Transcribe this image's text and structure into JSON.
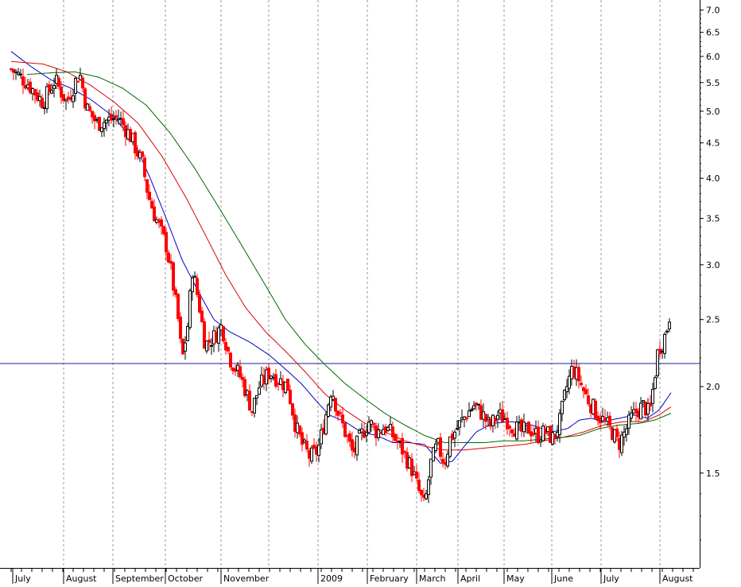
{
  "chart_data": {
    "type": "line",
    "title": "",
    "xlabel": "",
    "ylabel": "",
    "y_scale": "log",
    "ylim": [
      1.1,
      7.2
    ],
    "grid": "vertical dotted",
    "legend": "none",
    "y_ticks": [
      {
        "value": 7.0,
        "label": "7.0"
      },
      {
        "value": 6.5,
        "label": "6.5"
      },
      {
        "value": 6.0,
        "label": "6.0"
      },
      {
        "value": 5.5,
        "label": "5.5"
      },
      {
        "value": 5.0,
        "label": "5.0"
      },
      {
        "value": 4.5,
        "label": "4.5"
      },
      {
        "value": 4.0,
        "label": "4.0"
      },
      {
        "value": 3.5,
        "label": "3.5"
      },
      {
        "value": 3.0,
        "label": "3.0"
      },
      {
        "value": 2.5,
        "label": "2.5"
      },
      {
        "value": 2.0,
        "label": "2.0"
      },
      {
        "value": 1.5,
        "label": "1.5"
      }
    ],
    "x_labels": [
      {
        "label": "July",
        "t": 2
      },
      {
        "label": "August",
        "t": 66
      },
      {
        "label": "September",
        "t": 128
      },
      {
        "label": "October",
        "t": 194
      },
      {
        "label": "November",
        "t": 264
      },
      {
        "label": "2009",
        "t": 386
      },
      {
        "label": "February",
        "t": 448
      },
      {
        "label": "March",
        "t": 510
      },
      {
        "label": "April",
        "t": 562
      },
      {
        "label": "May",
        "t": 620
      },
      {
        "label": "June",
        "t": 680
      },
      {
        "label": "July",
        "t": 742
      },
      {
        "label": "August",
        "t": 816
      }
    ],
    "x_grid": [
      66,
      128,
      194,
      264,
      324,
      386,
      448,
      510,
      562,
      620,
      680,
      742,
      816
    ],
    "horizontal_line": {
      "value": 2.16,
      "color": "#1c1c9c"
    },
    "price_series": {
      "name": "",
      "up_color": "#000000",
      "down_color": "#ff0000",
      "anchors": [
        [
          0,
          5.75
        ],
        [
          20,
          5.5
        ],
        [
          40,
          5.15
        ],
        [
          55,
          5.55
        ],
        [
          70,
          5.15
        ],
        [
          86,
          5.7
        ],
        [
          95,
          5.05
        ],
        [
          108,
          4.8
        ],
        [
          135,
          4.9
        ],
        [
          150,
          4.6
        ],
        [
          165,
          4.2
        ],
        [
          172,
          3.8
        ],
        [
          180,
          3.55
        ],
        [
          195,
          3.2
        ],
        [
          202,
          2.9
        ],
        [
          210,
          2.5
        ],
        [
          215,
          2.18
        ],
        [
          222,
          2.45
        ],
        [
          228,
          2.95
        ],
        [
          236,
          2.65
        ],
        [
          244,
          2.3
        ],
        [
          254,
          2.35
        ],
        [
          265,
          2.45
        ],
        [
          275,
          2.2
        ],
        [
          290,
          2.05
        ],
        [
          303,
          1.85
        ],
        [
          312,
          2.0
        ],
        [
          325,
          2.1
        ],
        [
          336,
          2.05
        ],
        [
          348,
          2.0
        ],
        [
          358,
          1.75
        ],
        [
          366,
          1.65
        ],
        [
          376,
          1.58
        ],
        [
          386,
          1.62
        ],
        [
          395,
          1.8
        ],
        [
          403,
          2.0
        ],
        [
          410,
          1.85
        ],
        [
          420,
          1.72
        ],
        [
          430,
          1.6
        ],
        [
          440,
          1.7
        ],
        [
          450,
          1.78
        ],
        [
          460,
          1.72
        ],
        [
          470,
          1.75
        ],
        [
          480,
          1.7
        ],
        [
          492,
          1.62
        ],
        [
          504,
          1.52
        ],
        [
          512,
          1.42
        ],
        [
          520,
          1.34
        ],
        [
          528,
          1.55
        ],
        [
          536,
          1.65
        ],
        [
          545,
          1.55
        ],
        [
          552,
          1.68
        ],
        [
          562,
          1.75
        ],
        [
          572,
          1.82
        ],
        [
          582,
          1.88
        ],
        [
          592,
          1.83
        ],
        [
          602,
          1.75
        ],
        [
          612,
          1.82
        ],
        [
          622,
          1.8
        ],
        [
          632,
          1.75
        ],
        [
          642,
          1.72
        ],
        [
          652,
          1.74
        ],
        [
          662,
          1.7
        ],
        [
          672,
          1.72
        ],
        [
          682,
          1.68
        ],
        [
          690,
          1.78
        ],
        [
          698,
          1.98
        ],
        [
          706,
          2.13
        ],
        [
          714,
          2.05
        ],
        [
          722,
          1.95
        ],
        [
          730,
          1.88
        ],
        [
          738,
          1.82
        ],
        [
          746,
          1.78
        ],
        [
          756,
          1.72
        ],
        [
          764,
          1.65
        ],
        [
          772,
          1.72
        ],
        [
          780,
          1.8
        ],
        [
          788,
          1.85
        ],
        [
          796,
          1.88
        ],
        [
          803,
          1.82
        ],
        [
          810,
          2.1
        ],
        [
          814,
          2.28
        ],
        [
          818,
          2.3
        ],
        [
          824,
          2.4
        ],
        [
          830,
          2.6
        ]
      ]
    },
    "moving_averages": [
      {
        "name": "",
        "color": "#0000cc",
        "anchors": [
          [
            0,
            6.1
          ],
          [
            25,
            5.8
          ],
          [
            50,
            5.55
          ],
          [
            75,
            5.4
          ],
          [
            100,
            5.2
          ],
          [
            130,
            4.9
          ],
          [
            155,
            4.5
          ],
          [
            175,
            4.0
          ],
          [
            195,
            3.5
          ],
          [
            215,
            3.05
          ],
          [
            235,
            2.75
          ],
          [
            255,
            2.5
          ],
          [
            275,
            2.4
          ],
          [
            300,
            2.32
          ],
          [
            325,
            2.22
          ],
          [
            345,
            2.12
          ],
          [
            365,
            2.02
          ],
          [
            385,
            1.9
          ],
          [
            400,
            1.82
          ],
          [
            420,
            1.78
          ],
          [
            440,
            1.72
          ],
          [
            460,
            1.7
          ],
          [
            480,
            1.66
          ],
          [
            500,
            1.66
          ],
          [
            520,
            1.65
          ],
          [
            540,
            1.55
          ],
          [
            555,
            1.56
          ],
          [
            570,
            1.64
          ],
          [
            585,
            1.72
          ],
          [
            605,
            1.77
          ],
          [
            630,
            1.78
          ],
          [
            655,
            1.76
          ],
          [
            680,
            1.72
          ],
          [
            700,
            1.74
          ],
          [
            715,
            1.79
          ],
          [
            730,
            1.8
          ],
          [
            745,
            1.78
          ],
          [
            765,
            1.8
          ],
          [
            785,
            1.82
          ],
          [
            800,
            1.8
          ],
          [
            815,
            1.85
          ],
          [
            830,
            1.96
          ]
        ]
      },
      {
        "name": "",
        "color": "#dd0000",
        "anchors": [
          [
            0,
            5.9
          ],
          [
            40,
            5.85
          ],
          [
            70,
            5.7
          ],
          [
            100,
            5.45
          ],
          [
            130,
            5.15
          ],
          [
            160,
            4.8
          ],
          [
            190,
            4.3
          ],
          [
            220,
            3.75
          ],
          [
            245,
            3.3
          ],
          [
            270,
            2.9
          ],
          [
            295,
            2.6
          ],
          [
            320,
            2.4
          ],
          [
            345,
            2.25
          ],
          [
            370,
            2.1
          ],
          [
            395,
            1.95
          ],
          [
            420,
            1.85
          ],
          [
            445,
            1.77
          ],
          [
            470,
            1.72
          ],
          [
            495,
            1.67
          ],
          [
            520,
            1.64
          ],
          [
            545,
            1.62
          ],
          [
            570,
            1.62
          ],
          [
            595,
            1.63
          ],
          [
            620,
            1.64
          ],
          [
            645,
            1.65
          ],
          [
            670,
            1.67
          ],
          [
            695,
            1.69
          ],
          [
            720,
            1.72
          ],
          [
            745,
            1.76
          ],
          [
            770,
            1.78
          ],
          [
            795,
            1.78
          ],
          [
            815,
            1.82
          ],
          [
            830,
            1.87
          ]
        ]
      },
      {
        "name": "",
        "color": "#006600",
        "anchors": [
          [
            20,
            5.65
          ],
          [
            50,
            5.68
          ],
          [
            80,
            5.7
          ],
          [
            110,
            5.6
          ],
          [
            140,
            5.4
          ],
          [
            170,
            5.1
          ],
          [
            200,
            4.65
          ],
          [
            230,
            4.15
          ],
          [
            260,
            3.65
          ],
          [
            290,
            3.2
          ],
          [
            320,
            2.8
          ],
          [
            345,
            2.5
          ],
          [
            370,
            2.3
          ],
          [
            395,
            2.15
          ],
          [
            420,
            2.02
          ],
          [
            445,
            1.92
          ],
          [
            470,
            1.83
          ],
          [
            495,
            1.76
          ],
          [
            520,
            1.7
          ],
          [
            545,
            1.66
          ],
          [
            570,
            1.66
          ],
          [
            595,
            1.66
          ],
          [
            620,
            1.67
          ],
          [
            645,
            1.67
          ],
          [
            670,
            1.68
          ],
          [
            695,
            1.69
          ],
          [
            715,
            1.7
          ],
          [
            740,
            1.74
          ],
          [
            765,
            1.76
          ],
          [
            790,
            1.77
          ],
          [
            810,
            1.79
          ],
          [
            830,
            1.83
          ]
        ]
      }
    ]
  }
}
